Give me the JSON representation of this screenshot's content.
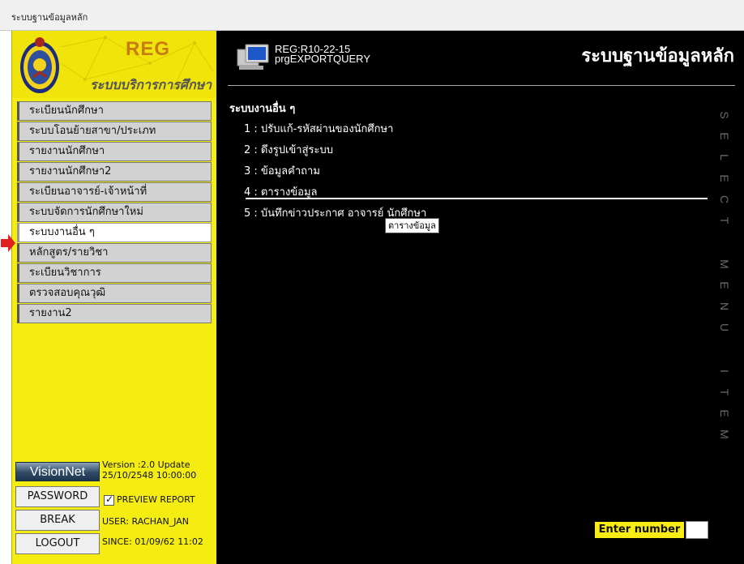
{
  "window": {
    "title": "ระบบฐานข้อมูลหลัก"
  },
  "brand": {
    "title": "REG",
    "subtitle": "ระบบบริการการศึกษา"
  },
  "menu": {
    "items": [
      {
        "label": "ระเบียนนักศึกษา"
      },
      {
        "label": "ระบบโอนย้ายสาขา/ประเภท"
      },
      {
        "label": "รายงานนักศึกษา"
      },
      {
        "label": "รายงานนักศึกษา2"
      },
      {
        "label": "ระเบียนอาจารย์-เจ้าหน้าที่"
      },
      {
        "label": "ระบบจัดการนักศึกษาใหม่"
      },
      {
        "label": "ระบบงานอื่น ๆ",
        "active": true
      },
      {
        "label": "หลักสูตร/รายวิชา"
      },
      {
        "label": "ระเบียนวิชาการ"
      },
      {
        "label": "ตรวจสอบคุณวุฒิ"
      },
      {
        "label": "รายงาน2"
      }
    ]
  },
  "footer": {
    "vision_label": "VisionNet",
    "version_line1": "Version :2.0 Update",
    "version_line2": "25/10/2548 10:00:00",
    "password_label": "PASSWORD",
    "preview_label": "PREVIEW REPORT",
    "break_label": "BREAK",
    "user_text": "USER: RACHAN_JAN",
    "logout_label": "LOGOUT",
    "since_text": "SINCE: 01/09/62 11:02"
  },
  "main": {
    "form_code": "REG:R10-22-15",
    "form_name": "prgEXPORTQUERY",
    "title": "ระบบฐานข้อมูลหลัก",
    "section_title": "ระบบงานอื่น ๆ",
    "options": [
      {
        "label": "1 : ปรับแก้-รหัสผ่านของนักศึกษา"
      },
      {
        "label": "2 : ดึงรูปเข้าสู่ระบบ"
      },
      {
        "label": "3 : ข้อมูลคำถาม"
      },
      {
        "label": "4 : ตารางข้อมูล",
        "highlighted": true
      },
      {
        "label": "5 : บันทึกข่าวประกาศ อาจารย์ นักศึกษา"
      }
    ],
    "tooltip": "ตารางข้อมูล",
    "vertical_label": "SELECT MENU ITEM",
    "enter_label": "Enter number",
    "enter_value": ""
  },
  "colors": {
    "panel_yellow": "#f5ec12",
    "main_background": "#000000",
    "menu_gray": "#d2d2d2",
    "arrow_red": "#e0201c",
    "enter_label_bg": "#f8ec14"
  },
  "icons": {
    "logo": "university-seal-icon",
    "form": "computer-monitor-icon",
    "indicator": "arrow-right-icon",
    "check": "checkmark-icon"
  }
}
